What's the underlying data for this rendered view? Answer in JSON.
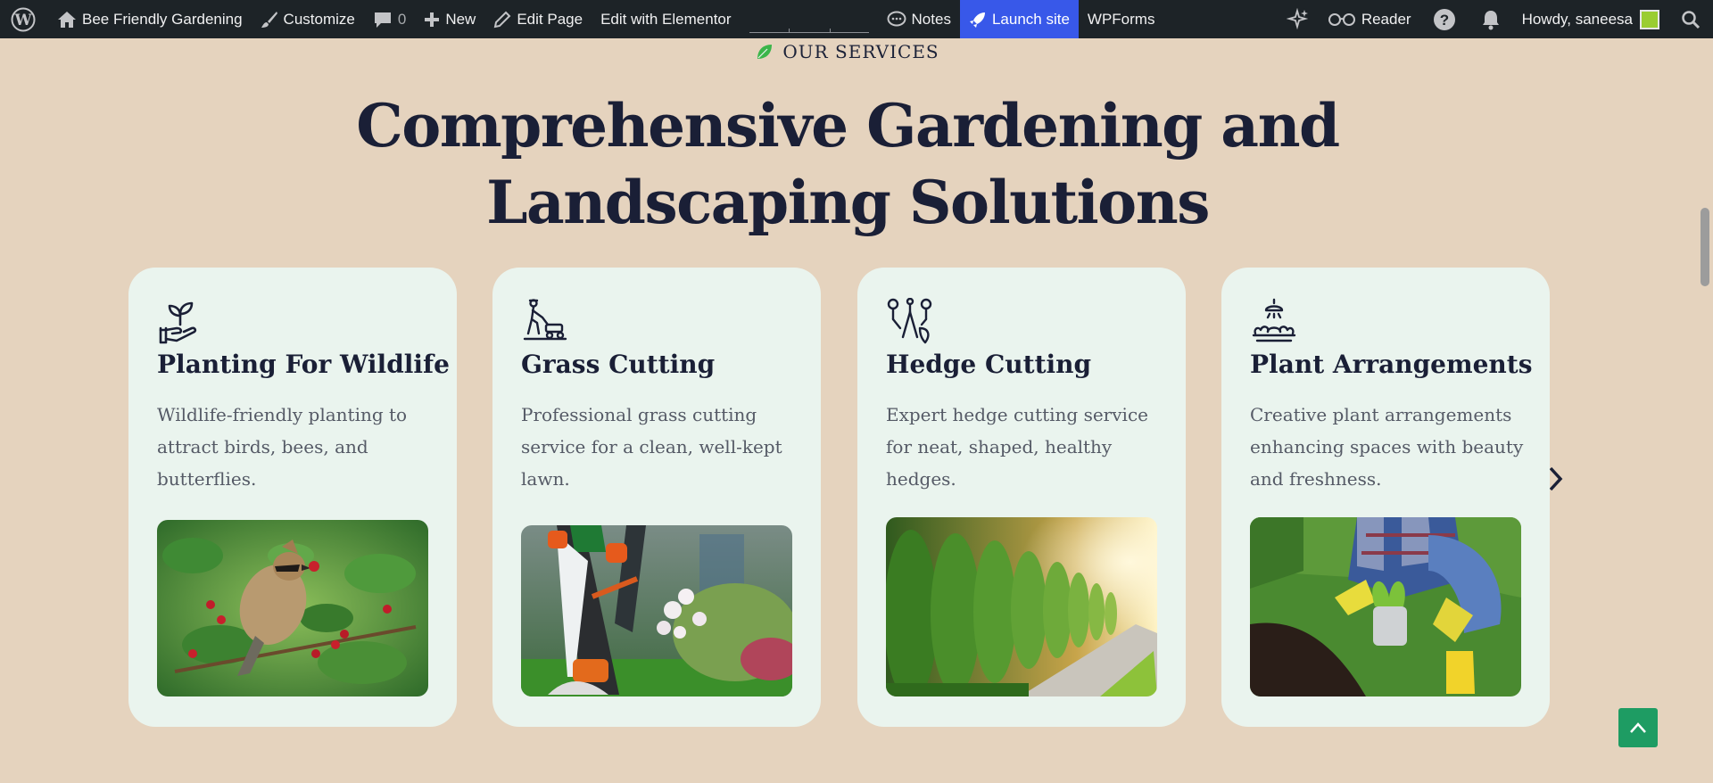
{
  "adminbar": {
    "site_name": "Bee Friendly Gardening",
    "customize": "Customize",
    "comments_count": "0",
    "new": "New",
    "edit_page": "Edit Page",
    "edit_elementor": "Edit with Elementor",
    "notes": "Notes",
    "launch_site": "Launch site",
    "wpforms": "WPForms",
    "reader": "Reader",
    "howdy": "Howdy, saneesa"
  },
  "section": {
    "eyebrow": "OUR SERVICES",
    "headline": "Comprehensive Gardening and Landscaping Solutions"
  },
  "cards": [
    {
      "title": "Planting For Wildlife",
      "desc": "Wildlife-friendly planting to attract birds, bees, and butterflies.",
      "icon": "hand-sprout-icon",
      "photo": "bird-on-berry-branch"
    },
    {
      "title": "Grass Cutting",
      "desc": "Professional grass cutting service for a clean, well-kept lawn.",
      "icon": "lawn-mower-icon",
      "photo": "trimmer-in-garden"
    },
    {
      "title": "Hedge Cutting",
      "desc": "Expert hedge cutting service for neat, shaped, healthy hedges.",
      "icon": "pruning-tools-icon",
      "photo": "trimmed-hedge-row"
    },
    {
      "title": "Plant Arrangements",
      "desc": "Creative plant arrangements enhancing spaces with beauty and freshness.",
      "icon": "flowers-sprinkler-icon",
      "photo": "gardener-planting"
    }
  ],
  "colors": {
    "adminbar": "#1d2327",
    "launch": "#3858e9",
    "page_bg": "#e5d3be",
    "card_bg": "#eaf4ee",
    "heading": "#1a1f36",
    "accent_green": "#1e9c63"
  }
}
